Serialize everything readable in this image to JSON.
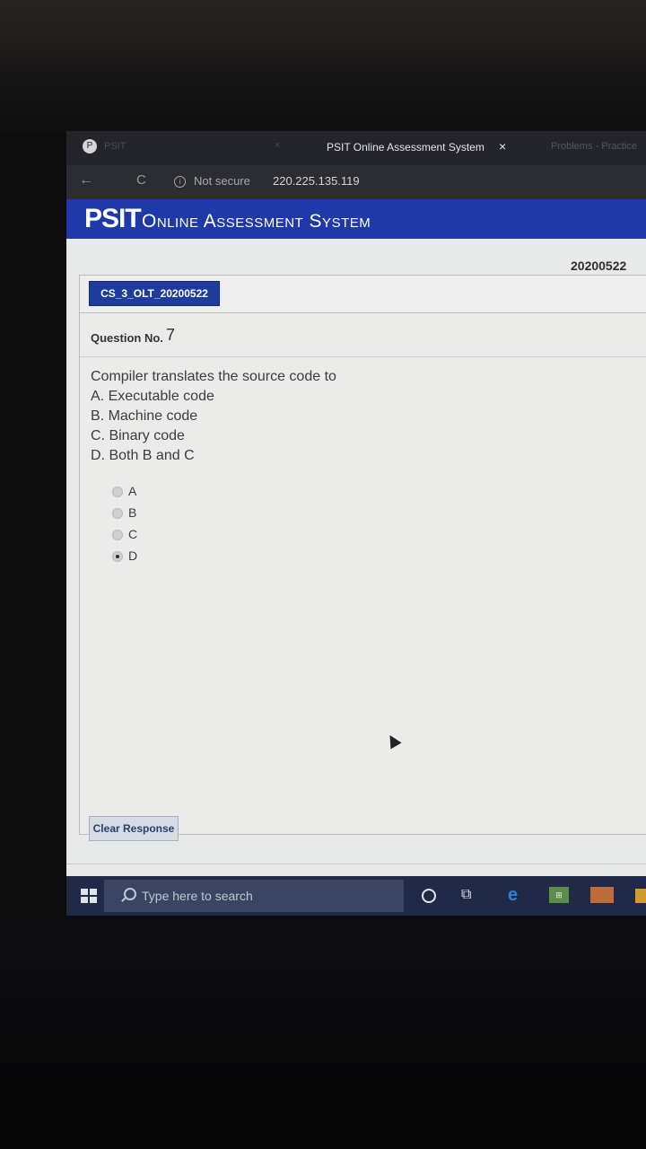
{
  "browser": {
    "tab_icon": "P",
    "ghost_tab": "PSIT",
    "ghost_tab_close": "×",
    "active_tab_title": "PSIT Online Assessment System",
    "tab_close": "×",
    "right_tab": "Problems - Practice",
    "back_glyph": "←",
    "reload_glyph": "C",
    "security_icon_glyph": "i",
    "security_label": "Not secure",
    "url": "220.225.135.119"
  },
  "site": {
    "brand_bold": "PSIT",
    "brand_rest": "Online Assessment System"
  },
  "exam": {
    "date_code": "20200522",
    "test_name": "CS_3_OLT_20200522",
    "question_label": "Question No.",
    "question_number": "7",
    "question_lines": [
      "Compiler translates the source code to",
      "A. Executable code",
      "B. Machine code",
      "C. Binary code",
      "D. Both B and C"
    ],
    "options": [
      "A",
      "B",
      "C",
      "D"
    ],
    "selected_option": "D",
    "clear_button": "Clear Response"
  },
  "taskbar": {
    "search_placeholder": "Type here to search",
    "store_label": "⊞",
    "taskview_glyph": "⧉",
    "edge_glyph": "e"
  },
  "colors": {
    "header_blue": "#1f3aa8",
    "chip_blue": "#1d3c9c",
    "taskbar": "#202a47"
  }
}
